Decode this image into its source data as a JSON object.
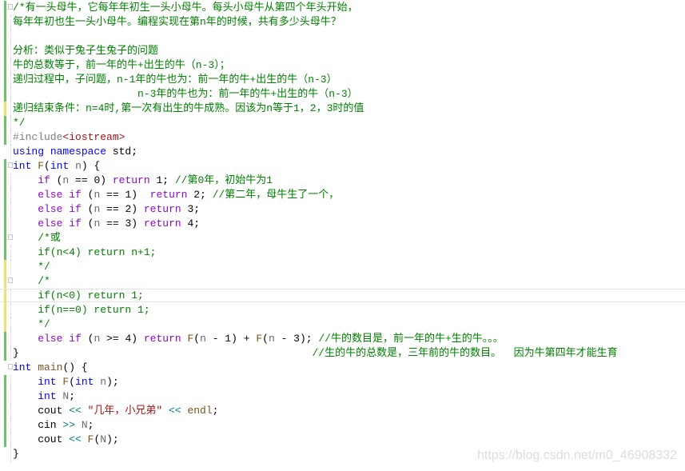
{
  "editor": {
    "lines": [
      {
        "g": "g",
        "fold": true,
        "t": [
          [
            "/*有一头母牛，它每年年初生一头小母牛。每头小母牛从第四个年头开始，",
            "cm"
          ]
        ]
      },
      {
        "g": "g",
        "t": [
          [
            "每年年初也生一头小母牛。编程实现在第n年的时候，共有多少头母牛？",
            "cm"
          ]
        ]
      },
      {
        "g": "g",
        "t": []
      },
      {
        "g": "g",
        "t": [
          [
            "分析：类似于兔子生兔子的问题",
            "cm"
          ]
        ]
      },
      {
        "g": "g",
        "t": [
          [
            "牛的总数等于，前一年的牛+出生的牛（n-3）；",
            "cm"
          ]
        ]
      },
      {
        "g": "g",
        "t": [
          [
            "递归过程中，子问题，n-1年的牛也为：前一年的牛+出生的牛（n-3）",
            "cm"
          ]
        ]
      },
      {
        "g": "g",
        "t": [
          [
            "                    n-3年的牛也为：前一年的牛+出生的牛（n-3）",
            "cm"
          ]
        ]
      },
      {
        "g": "y",
        "t": [
          [
            "递归结束条件：n=4时,第一次有出生的牛成熟。因该为n等于1，2，3时的值",
            "cm"
          ]
        ]
      },
      {
        "g": "g",
        "t": [
          [
            "*/",
            "cm"
          ]
        ]
      },
      {
        "g": "g",
        "t": [
          [
            "#include",
            "pp"
          ],
          [
            "<iostream>",
            "str"
          ]
        ]
      },
      {
        "g": "",
        "t": [
          [
            "using ",
            "kw"
          ],
          [
            "namespace ",
            "kw"
          ],
          [
            "std;",
            "pl"
          ]
        ]
      },
      {
        "g": "g",
        "fold": true,
        "t": [
          [
            "int ",
            "kw"
          ],
          [
            "F",
            "fn"
          ],
          [
            "(",
            "pl"
          ],
          [
            "int ",
            "kw"
          ],
          [
            "n",
            "var"
          ],
          [
            ") {",
            "pl"
          ]
        ]
      },
      {
        "g": "g",
        "t": [
          [
            "    if ",
            "ct"
          ],
          [
            "(",
            "pl"
          ],
          [
            "n",
            "var"
          ],
          [
            " == 0) ",
            "pl"
          ],
          [
            "return ",
            "ct"
          ],
          [
            "1; ",
            "pl"
          ],
          [
            "//第0年，初始牛为1",
            "cm"
          ]
        ]
      },
      {
        "g": "g",
        "t": [
          [
            "    else if ",
            "ct"
          ],
          [
            "(",
            "pl"
          ],
          [
            "n",
            "var"
          ],
          [
            " == 1)  ",
            "pl"
          ],
          [
            "return ",
            "ct"
          ],
          [
            "2; ",
            "pl"
          ],
          [
            "//第二年，母牛生了一个，",
            "cm"
          ]
        ]
      },
      {
        "g": "g",
        "t": [
          [
            "    else if ",
            "ct"
          ],
          [
            "(",
            "pl"
          ],
          [
            "n",
            "var"
          ],
          [
            " == 2) ",
            "pl"
          ],
          [
            "return ",
            "ct"
          ],
          [
            "3;",
            "pl"
          ]
        ]
      },
      {
        "g": "g",
        "t": [
          [
            "    else if ",
            "ct"
          ],
          [
            "(",
            "pl"
          ],
          [
            "n",
            "var"
          ],
          [
            " == 3) ",
            "pl"
          ],
          [
            "return ",
            "ct"
          ],
          [
            "4;",
            "pl"
          ]
        ]
      },
      {
        "g": "g",
        "fold": true,
        "t": [
          [
            "    /*或",
            "cm"
          ]
        ]
      },
      {
        "g": "g",
        "t": [
          [
            "    if(n<4) return n+1;",
            "cm"
          ]
        ]
      },
      {
        "g": "y",
        "t": [
          [
            "    */",
            "cm"
          ]
        ]
      },
      {
        "g": "y",
        "fold": true,
        "t": [
          [
            "    /*",
            "cm"
          ]
        ]
      },
      {
        "g": "y",
        "current": true,
        "t": [
          [
            "    if(n<0) return 1;",
            "cm"
          ]
        ]
      },
      {
        "g": "y",
        "t": [
          [
            "    if(n==0) return 1;",
            "cm"
          ]
        ]
      },
      {
        "g": "y",
        "t": [
          [
            "    */",
            "cm"
          ]
        ]
      },
      {
        "g": "g",
        "t": [
          [
            "    else if ",
            "ct"
          ],
          [
            "(",
            "pl"
          ],
          [
            "n",
            "var"
          ],
          [
            " >= 4) ",
            "pl"
          ],
          [
            "return ",
            "ct"
          ],
          [
            "F",
            "fn"
          ],
          [
            "(",
            "pl"
          ],
          [
            "n",
            "var"
          ],
          [
            " - 1) + ",
            "pl"
          ],
          [
            "F",
            "fn"
          ],
          [
            "(",
            "pl"
          ],
          [
            "n",
            "var"
          ],
          [
            " - 3); ",
            "pl"
          ],
          [
            "//牛的数目是，前一年的牛+生的牛。。。",
            "cm"
          ]
        ]
      },
      {
        "g": "g",
        "t": [
          [
            "}                                               ",
            "pl"
          ],
          [
            "//生的牛的总数是，三年前的牛的数目。  因为牛第四年才能生育",
            "cm"
          ]
        ]
      },
      {
        "g": "",
        "fold": true,
        "t": [
          [
            "int ",
            "kw"
          ],
          [
            "main",
            "fn"
          ],
          [
            "() {",
            "pl"
          ]
        ]
      },
      {
        "g": "g",
        "t": [
          [
            "    int ",
            "kw"
          ],
          [
            "F",
            "fn"
          ],
          [
            "(",
            "pl"
          ],
          [
            "int ",
            "kw"
          ],
          [
            "n",
            "var"
          ],
          [
            ");",
            "pl"
          ]
        ]
      },
      {
        "g": "g",
        "t": [
          [
            "    int ",
            "kw"
          ],
          [
            "N",
            "var"
          ],
          [
            ";",
            "pl"
          ]
        ]
      },
      {
        "g": "g",
        "t": [
          [
            "    cout ",
            "pl"
          ],
          [
            "<< ",
            "op"
          ],
          [
            "\"几年，小兄弟\"",
            "str"
          ],
          [
            " << ",
            "op"
          ],
          [
            "endl",
            "fn"
          ],
          [
            ";",
            "pl"
          ]
        ]
      },
      {
        "g": "g",
        "t": [
          [
            "    cin ",
            "pl"
          ],
          [
            ">> ",
            "op"
          ],
          [
            "N",
            "var"
          ],
          [
            ";",
            "pl"
          ]
        ]
      },
      {
        "g": "g",
        "t": [
          [
            "    cout ",
            "pl"
          ],
          [
            "<< ",
            "op"
          ],
          [
            "F",
            "fn"
          ],
          [
            "(",
            "pl"
          ],
          [
            "N",
            "var"
          ],
          [
            ");",
            "pl"
          ]
        ]
      },
      {
        "g": "",
        "t": [
          [
            "}",
            "pl"
          ]
        ]
      }
    ]
  },
  "watermark": "https://blog.csdn.net/m0_46908332",
  "colors": {
    "comment": "#008000",
    "keyword": "#0000ff",
    "control": "#8f08c4",
    "string": "#a31515",
    "change_saved": "#6cc36c",
    "change_unsaved": "#efe072"
  }
}
